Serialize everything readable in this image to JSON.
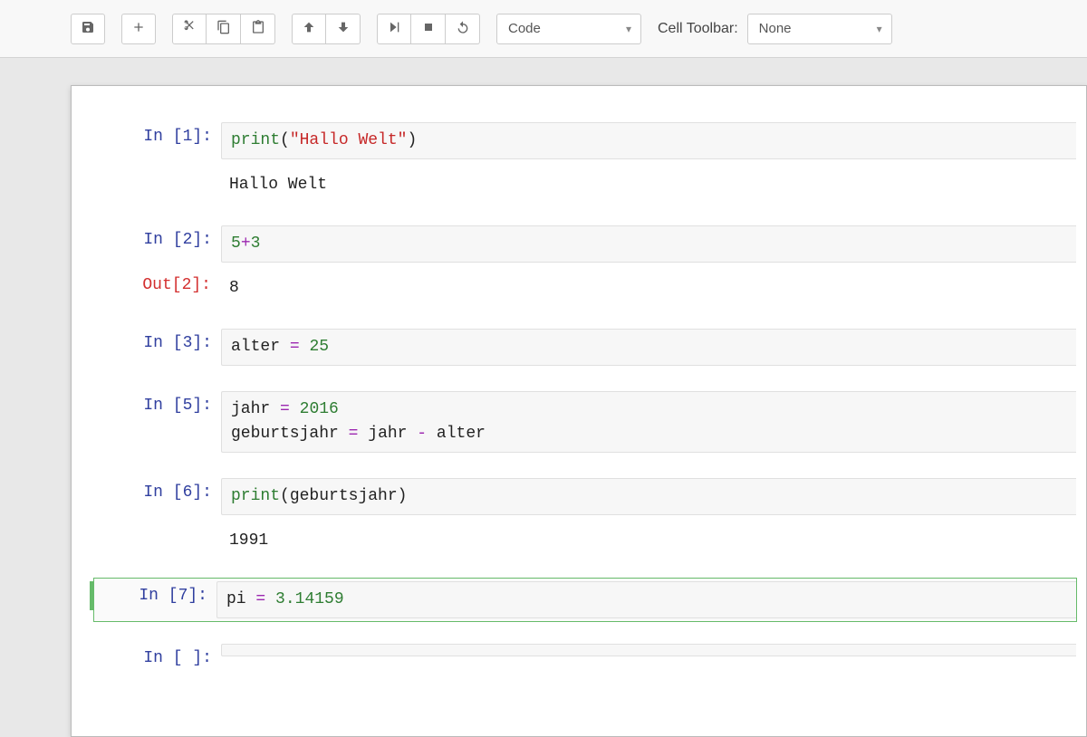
{
  "toolbar": {
    "cell_type_selected": "Code",
    "cell_toolbar_label": "Cell Toolbar:",
    "cell_toolbar_selected": "None"
  },
  "cells": [
    {
      "prompt": "In [1]:",
      "code_html": "<span class='tok-fn'>print</span>(<span class='tok-str'>\"Hallo Welt\"</span>)",
      "stdout": "Hallo Welt"
    },
    {
      "prompt": "In [2]:",
      "code_html": "<span class='tok-num'>5</span><span class='tok-op'>+</span><span class='tok-num'>3</span>",
      "out_prompt": "Out[2]:",
      "out_value": "8"
    },
    {
      "prompt": "In [3]:",
      "code_html": "<span class='tok-var'>alter</span> <span class='tok-op'>=</span> <span class='tok-num'>25</span>"
    },
    {
      "prompt": "In [5]:",
      "code_html": "<span class='tok-var'>jahr</span> <span class='tok-op'>=</span> <span class='tok-num'>2016</span>\n<span class='tok-var'>geburtsjahr</span> <span class='tok-op'>=</span> <span class='tok-var'>jahr</span> <span class='tok-op'>-</span> <span class='tok-var'>alter</span>"
    },
    {
      "prompt": "In [6]:",
      "code_html": "<span class='tok-fn'>print</span>(<span class='tok-var'>geburtsjahr</span>)",
      "stdout": "1991"
    },
    {
      "prompt": "In [7]:",
      "code_html": "<span class='tok-var'>pi</span> <span class='tok-op'>=</span> <span class='tok-num'>3.14159</span>",
      "selected": true
    },
    {
      "prompt": "In [ ]:",
      "code_html": ""
    }
  ]
}
